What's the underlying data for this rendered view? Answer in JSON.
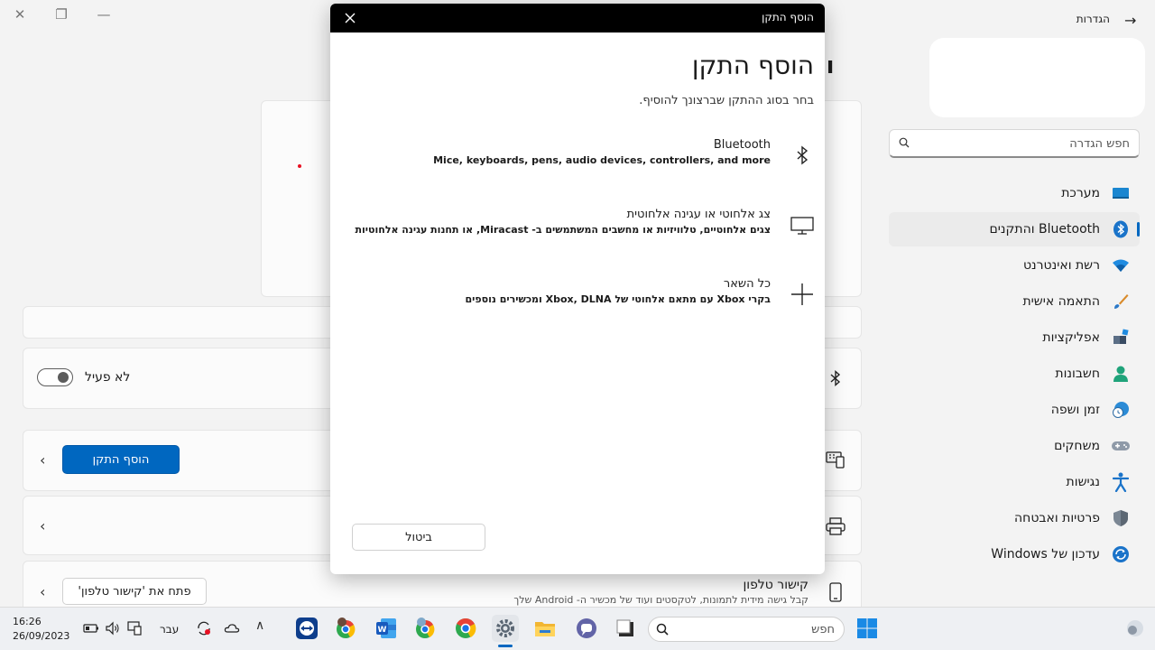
{
  "window": {
    "title": "הגדרות",
    "minimize_icon": "minimize-icon",
    "maximize_icon": "restore-icon",
    "close_icon": "close-icon",
    "back_icon": "back-arrow-icon"
  },
  "sidebar": {
    "search_placeholder": "חפש הגדרה",
    "items": [
      {
        "label": "מערכת",
        "icon": "system-icon"
      },
      {
        "label": "Bluetooth והתקנים",
        "icon": "bluetooth-icon",
        "selected": true
      },
      {
        "label": "רשת ואינטרנט",
        "icon": "wifi-icon"
      },
      {
        "label": "התאמה אישית",
        "icon": "brush-icon"
      },
      {
        "label": "אפליקציות",
        "icon": "apps-icon"
      },
      {
        "label": "חשבונות",
        "icon": "account-icon"
      },
      {
        "label": "זמן ושפה",
        "icon": "time-language-icon"
      },
      {
        "label": "משחקים",
        "icon": "gamepad-icon"
      },
      {
        "label": "נגישות",
        "icon": "accessibility-icon"
      },
      {
        "label": "פרטיות ואבטחה",
        "icon": "shield-icon"
      },
      {
        "label": "עדכון של Windows",
        "icon": "windows-update-icon"
      }
    ]
  },
  "main": {
    "heading_partial": "והת",
    "bluetooth_toggle_label": "לא פעיל",
    "add_device_button": "הוסף התקן",
    "phone_link": {
      "title": "קישור טלפון",
      "description": "קבל גישה מידית לתמונות, לטקסטים ועוד של מכשיר ה- Android שלך",
      "button": "פתח את 'קישור טלפון'"
    }
  },
  "dialog": {
    "title": "הוסף התקן",
    "heading": "הוסף התקן",
    "subtitle": "בחר בסוג ההתקן שברצונך להוסיף.",
    "options": [
      {
        "title": "Bluetooth",
        "description": "Mice, keyboards, pens, audio devices, controllers, and more",
        "icon": "bluetooth-icon"
      },
      {
        "title": "צג אלחוטי או עגינה אלחוטית",
        "description": "צגים אלחוטיים, טלוויזיות או מחשבים המשתמשים ב- Miracast, או תחנות עגינה אלחוטיות",
        "icon": "monitor-icon"
      },
      {
        "title": "כל השאר",
        "description": "בקרי Xbox עם מתאם אלחוטי של Xbox, DLNA ומכשירים נוספים",
        "icon": "plus-icon"
      }
    ],
    "cancel_button": "ביטול"
  },
  "taskbar": {
    "time": "16:26",
    "date": "26/09/2023",
    "language": "עבר",
    "search_placeholder": "חפש",
    "apps": [
      "teamviewer-icon",
      "chrome-profile-icon",
      "word-icon",
      "chrome-profile-2-icon",
      "chrome-icon",
      "settings-icon",
      "file-explorer-icon",
      "chat-icon",
      "window-app-icon"
    ]
  },
  "colors": {
    "accent": "#0067c0",
    "dialog_titlebar": "#000000",
    "background": "#f3f3f3"
  }
}
